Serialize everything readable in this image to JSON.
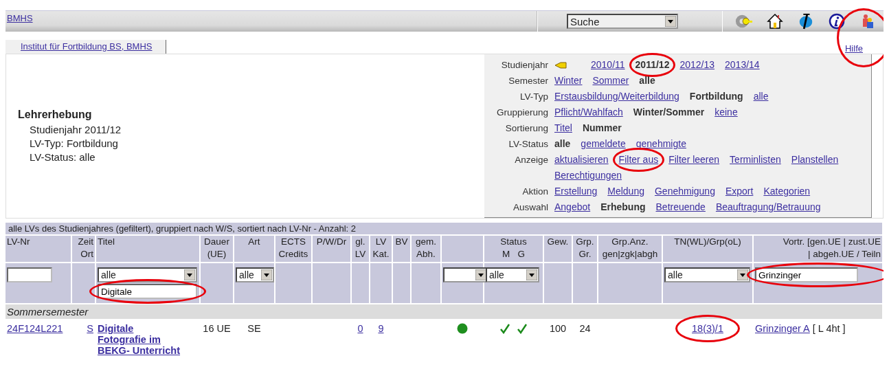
{
  "topbar": {
    "home_link": "BMHS",
    "search": {
      "value": "Suche"
    }
  },
  "tab": {
    "label": "Institut für Fortbildung BS, BMHS"
  },
  "help": {
    "label": "Hilfe",
    "highlighted": true
  },
  "summary": {
    "title": "Lehrerhebung",
    "lines": [
      "Studienjahr 2011/12",
      "LV-Typ: Fortbildung",
      "LV-Status: alle"
    ]
  },
  "filters": [
    {
      "label": "Studienjahr",
      "kind": "years",
      "options": [
        {
          "label": "2010/11",
          "selected": false
        },
        {
          "label": "2011/12",
          "selected": true,
          "highlighted": true
        },
        {
          "label": "2012/13",
          "selected": false
        },
        {
          "label": "2013/14",
          "selected": false
        }
      ]
    },
    {
      "label": "Semester",
      "kind": "plain",
      "options": [
        {
          "label": "Winter",
          "selected": false
        },
        {
          "label": "Sommer",
          "selected": false
        },
        {
          "label": "alle",
          "selected": true
        }
      ]
    },
    {
      "label": "LV-Typ",
      "kind": "plain",
      "options": [
        {
          "label": "Erstausbildung/Weiterbildung",
          "selected": false
        },
        {
          "label": "Fortbildung",
          "selected": true
        },
        {
          "label": "alle",
          "selected": false
        }
      ]
    },
    {
      "label": "Gruppierung",
      "kind": "plain",
      "options": [
        {
          "label": "Pflicht/Wahlfach",
          "selected": false
        },
        {
          "label": "Winter/Sommer",
          "selected": true
        },
        {
          "label": "keine",
          "selected": false
        }
      ]
    },
    {
      "label": "Sortierung",
      "kind": "plain",
      "options": [
        {
          "label": "Titel",
          "selected": false
        },
        {
          "label": "Nummer",
          "selected": true
        }
      ]
    },
    {
      "label": "LV-Status",
      "kind": "plain",
      "options": [
        {
          "label": "alle",
          "selected": true
        },
        {
          "label": "gemeldete",
          "selected": false
        },
        {
          "label": "genehmigte",
          "selected": false
        }
      ]
    },
    {
      "label": "Anzeige",
      "kind": "plain",
      "options": [
        {
          "label": "aktualisieren",
          "selected": false
        },
        {
          "label": "Filter aus",
          "selected": false,
          "highlighted": true
        },
        {
          "label": "Filter leeren",
          "selected": false
        },
        {
          "label": "Terminlisten",
          "selected": false
        },
        {
          "label": "Planstellen",
          "selected": false
        },
        {
          "label": "Berechtigungen",
          "selected": false
        }
      ]
    },
    {
      "label": "Aktion",
      "kind": "plain",
      "options": [
        {
          "label": "Erstellung",
          "selected": false
        },
        {
          "label": "Meldung",
          "selected": false
        },
        {
          "label": "Genehmigung",
          "selected": false
        },
        {
          "label": "Export",
          "selected": false
        },
        {
          "label": "Kategorien",
          "selected": false
        }
      ]
    },
    {
      "label": "Auswahl",
      "kind": "plain",
      "options": [
        {
          "label": "Angebot",
          "selected": false
        },
        {
          "label": "Erhebung",
          "selected": true
        },
        {
          "label": "Betreuende",
          "selected": false
        },
        {
          "label": "Beauftragung/Betrauung",
          "selected": false
        }
      ]
    }
  ],
  "table": {
    "caption": "alle LVs des Studienjahres (gefiltert), gruppiert nach W/S, sortiert nach LV-Nr - Anzahl: 2",
    "columns": [
      {
        "lines": [
          "LV-Nr"
        ],
        "filter": [
          {
            "kind": "input"
          }
        ]
      },
      {
        "lines": [
          "Zeit",
          "Ort"
        ]
      },
      {
        "lines": [
          "Titel"
        ],
        "filter": [
          {
            "kind": "select",
            "value": "alle"
          },
          {
            "kind": "input",
            "value": "Digitale",
            "highlighted": true
          }
        ]
      },
      {
        "lines": [
          "Dauer",
          "(UE)"
        ]
      },
      {
        "lines": [
          "Art"
        ],
        "filter": [
          {
            "kind": "select",
            "value": "alle"
          }
        ]
      },
      {
        "lines": [
          "ECTS",
          "Credits"
        ]
      },
      {
        "lines": [
          "P/W/Dr"
        ]
      },
      {
        "lines": [
          "gl.",
          "LV"
        ]
      },
      {
        "lines": [
          "LV",
          "Kat."
        ]
      },
      {
        "lines": [
          "BV"
        ]
      },
      {
        "lines": [
          "gem.",
          "Abh."
        ]
      },
      {
        "filter": [
          {
            "kind": "select"
          }
        ]
      },
      {
        "lines": [
          "Status",
          "M   G"
        ],
        "filter": [
          {
            "kind": "select",
            "value": "alle"
          }
        ]
      },
      {
        "lines": [
          "Gew."
        ]
      },
      {
        "lines": [
          "Grp.",
          "Gr."
        ]
      },
      {
        "lines": [
          "Grp.Anz.",
          "gen|zgk|abgh"
        ]
      },
      {
        "lines": [
          "TN(WL)/Grp(oL)"
        ],
        "filter": [
          {
            "kind": "select",
            "value": "alle"
          }
        ]
      },
      {
        "lines": [
          "Vortr. [gen.UE | zust.UE",
          "| abgeh.UE / Teiln"
        ],
        "filter": [
          {
            "kind": "input",
            "value": "Grinzinger",
            "highlighted": true
          }
        ]
      }
    ],
    "groups": [
      {
        "title": "Sommersemester",
        "rows": [
          {
            "cells": [
              {
                "kind": "link",
                "text": "24F124L221"
              },
              {
                "kind": "link",
                "text": "S"
              },
              {
                "kind": "title",
                "text": "Digitale Fotografie im BEKG- Unterricht"
              },
              {
                "kind": "text",
                "text": "16 UE"
              },
              {
                "kind": "text",
                "text": "SE"
              },
              {
                "kind": "empty"
              },
              {
                "kind": "empty"
              },
              {
                "kind": "link",
                "text": "0"
              },
              {
                "kind": "link",
                "text": "9"
              },
              {
                "kind": "empty"
              },
              {
                "kind": "empty"
              },
              {
                "kind": "dot",
                "color": "#1f8f1f"
              },
              {
                "kind": "checks",
                "m": true,
                "g": true
              },
              {
                "kind": "text",
                "text": "100"
              },
              {
                "kind": "text",
                "text": "24"
              },
              {
                "kind": "empty"
              },
              {
                "kind": "link",
                "text": "18(3)/1",
                "highlighted": true
              },
              {
                "kind": "lecturer",
                "name": "Grinzinger A",
                "detail": "[ L 4ht ]"
              }
            ]
          }
        ]
      }
    ]
  }
}
